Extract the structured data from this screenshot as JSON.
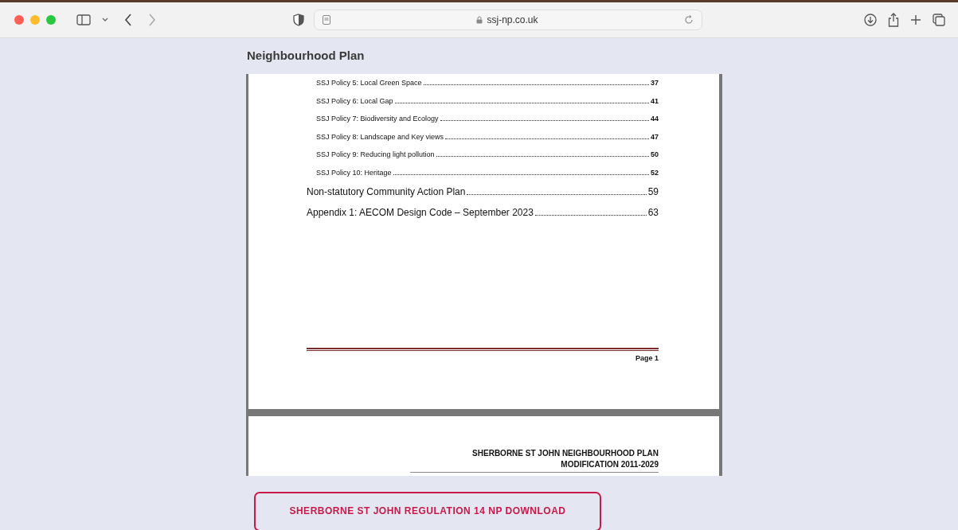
{
  "browser": {
    "url": "ssj-np.co.uk"
  },
  "page": {
    "heading": "Neighbourhood Plan"
  },
  "document": {
    "toc": [
      {
        "kind": "sub",
        "title": "SSJ Policy 5: Local Green Space",
        "page": "37"
      },
      {
        "kind": "sub",
        "title": "SSJ Policy 6: Local Gap",
        "page": "41"
      },
      {
        "kind": "sub",
        "title": "SSJ Policy 7: Biodiversity and Ecology",
        "page": "44"
      },
      {
        "kind": "sub",
        "title": "SSJ Policy 8: Landscape and Key views",
        "page": "47"
      },
      {
        "kind": "sub",
        "title": "SSJ Policy 9: Reducing light pollution",
        "page": "50"
      },
      {
        "kind": "sub",
        "title": "SSJ Policy 10: Heritage",
        "page": "52"
      },
      {
        "kind": "main",
        "title": "Non-statutory Community Action Plan",
        "page": "59"
      },
      {
        "kind": "main",
        "title": "Appendix 1: AECOM Design Code – September 2023",
        "page": "63"
      }
    ],
    "footer": "Page 1",
    "next_page_header": [
      "SHERBORNE ST JOHN NEIGHBOURHOOD PLAN",
      "MODIFICATION 2011-2029"
    ]
  },
  "download_button": "SHERBORNE ST JOHN REGULATION 14 NP DOWNLOAD"
}
